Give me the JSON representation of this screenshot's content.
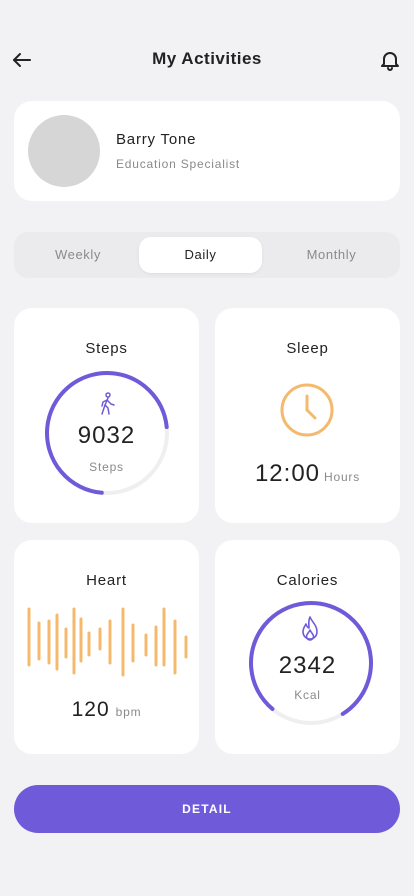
{
  "header": {
    "title": "My Activities",
    "back_icon": "arrow-left-icon",
    "bell_icon": "bell-icon"
  },
  "profile": {
    "name": "Barry Tone",
    "role": "Education Specialist"
  },
  "tabs": [
    {
      "label": "Weekly",
      "active": false
    },
    {
      "label": "Daily",
      "active": true
    },
    {
      "label": "Monthly",
      "active": false
    }
  ],
  "cards": {
    "steps": {
      "title": "Steps",
      "value": "9032",
      "unit": "Steps",
      "progress": 0.72,
      "icon": "walking-icon"
    },
    "sleep": {
      "title": "Sleep",
      "value": "12:00",
      "unit": "Hours",
      "icon": "clock-icon"
    },
    "heart": {
      "title": "Heart",
      "value": "120",
      "unit": "bpm",
      "icon": "heartbeat-wave"
    },
    "calories": {
      "title": "Calories",
      "value": "2342",
      "unit": "Kcal",
      "progress": 0.8,
      "icon": "fire-icon"
    }
  },
  "detail_button": {
    "label": "DETAIL"
  },
  "colors": {
    "accent": "#6f5bd9",
    "orange": "#f5b96e",
    "background": "#f2f2f4",
    "track": "#efeff2"
  }
}
